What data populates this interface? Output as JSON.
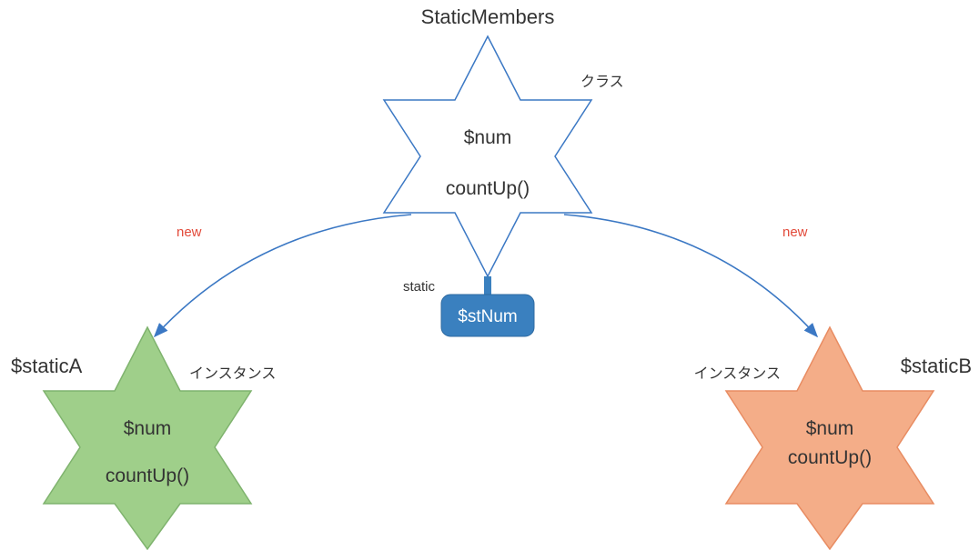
{
  "top": {
    "title": "StaticMembers",
    "class_label": "クラス",
    "property": "$num",
    "method": "countUp()"
  },
  "static": {
    "label": "static",
    "value": "$stNum"
  },
  "arrows": {
    "left_label": "new",
    "right_label": "new"
  },
  "left": {
    "name": "$staticA",
    "instance_label": "インスタンス",
    "property": "$num",
    "method": "countUp()"
  },
  "right": {
    "name": "$staticB",
    "instance_label": "インスタンス",
    "property": "$num",
    "method": "countUp()"
  },
  "colors": {
    "blue_stroke": "#3b78c4",
    "blue_fill": "#3a80bf",
    "green_stroke": "#7fb36e",
    "green_fill": "#9fcf8a",
    "orange_stroke": "#e88c62",
    "orange_fill": "#f4ad88",
    "red": "#e24a3a",
    "text": "#333333"
  }
}
